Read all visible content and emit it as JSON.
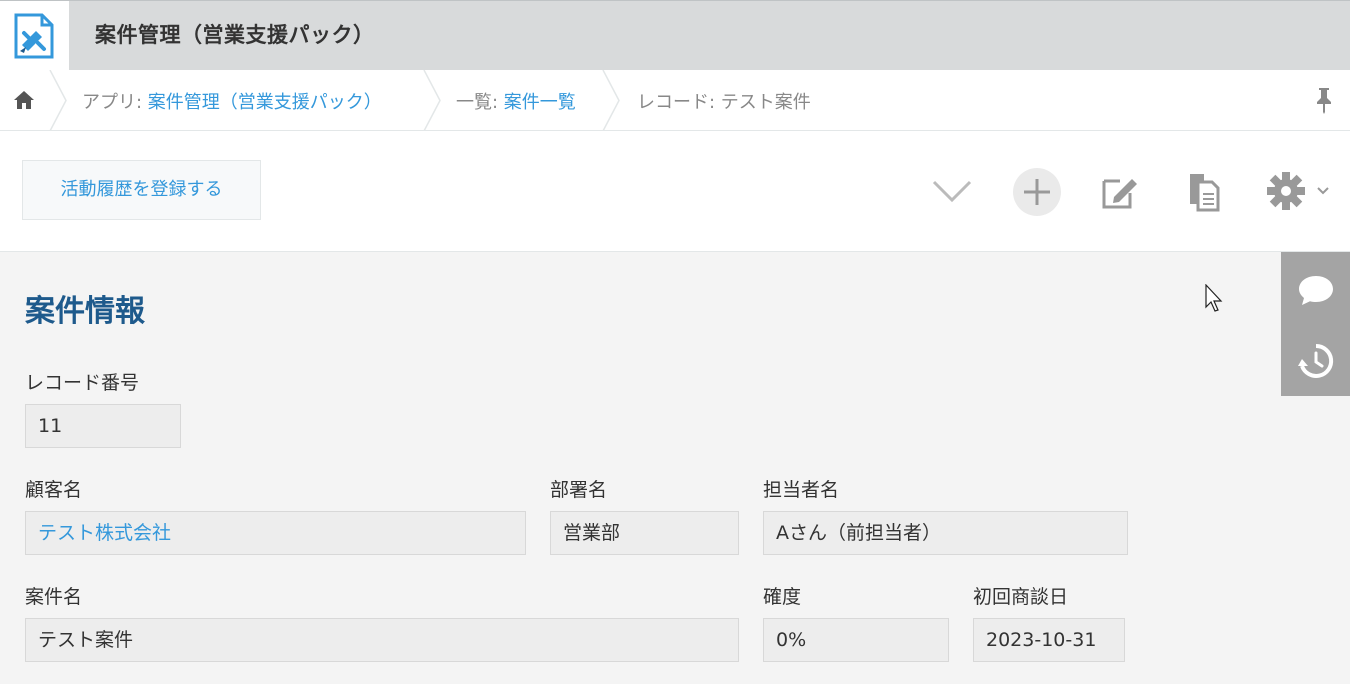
{
  "app": {
    "title": "案件管理（営業支援パック）"
  },
  "breadcrumb": {
    "app_prefix": "アプリ: ",
    "app_name": "案件管理（営業支援パック）",
    "list_prefix": "一覧: ",
    "list_name": "案件一覧",
    "record_prefix": "レコード: ",
    "record_name": "テスト案件"
  },
  "toolbar": {
    "action_label": "活動履歴を登録する"
  },
  "section": {
    "title": "案件情報"
  },
  "fields": {
    "record_number": {
      "label": "レコード番号",
      "value": "11"
    },
    "customer": {
      "label": "顧客名",
      "value": "テスト株式会社"
    },
    "department": {
      "label": "部署名",
      "value": "営業部"
    },
    "person": {
      "label": "担当者名",
      "value": "Aさん（前担当者）"
    },
    "deal_name": {
      "label": "案件名",
      "value": "テスト案件"
    },
    "probability": {
      "label": "確度",
      "value": "0%"
    },
    "first_meeting": {
      "label": "初回商談日",
      "value": "2023-10-31"
    }
  },
  "colors": {
    "accent": "#3498db",
    "section_title": "#1e5a8c",
    "header_bg": "#d8dadb",
    "side_panel": "#a4a4a4"
  },
  "icons": [
    "app-icon",
    "home-icon",
    "pin-icon",
    "chevron-down-icon",
    "plus-icon",
    "edit-icon",
    "copy-icon",
    "gear-icon",
    "comment-icon",
    "history-icon"
  ]
}
